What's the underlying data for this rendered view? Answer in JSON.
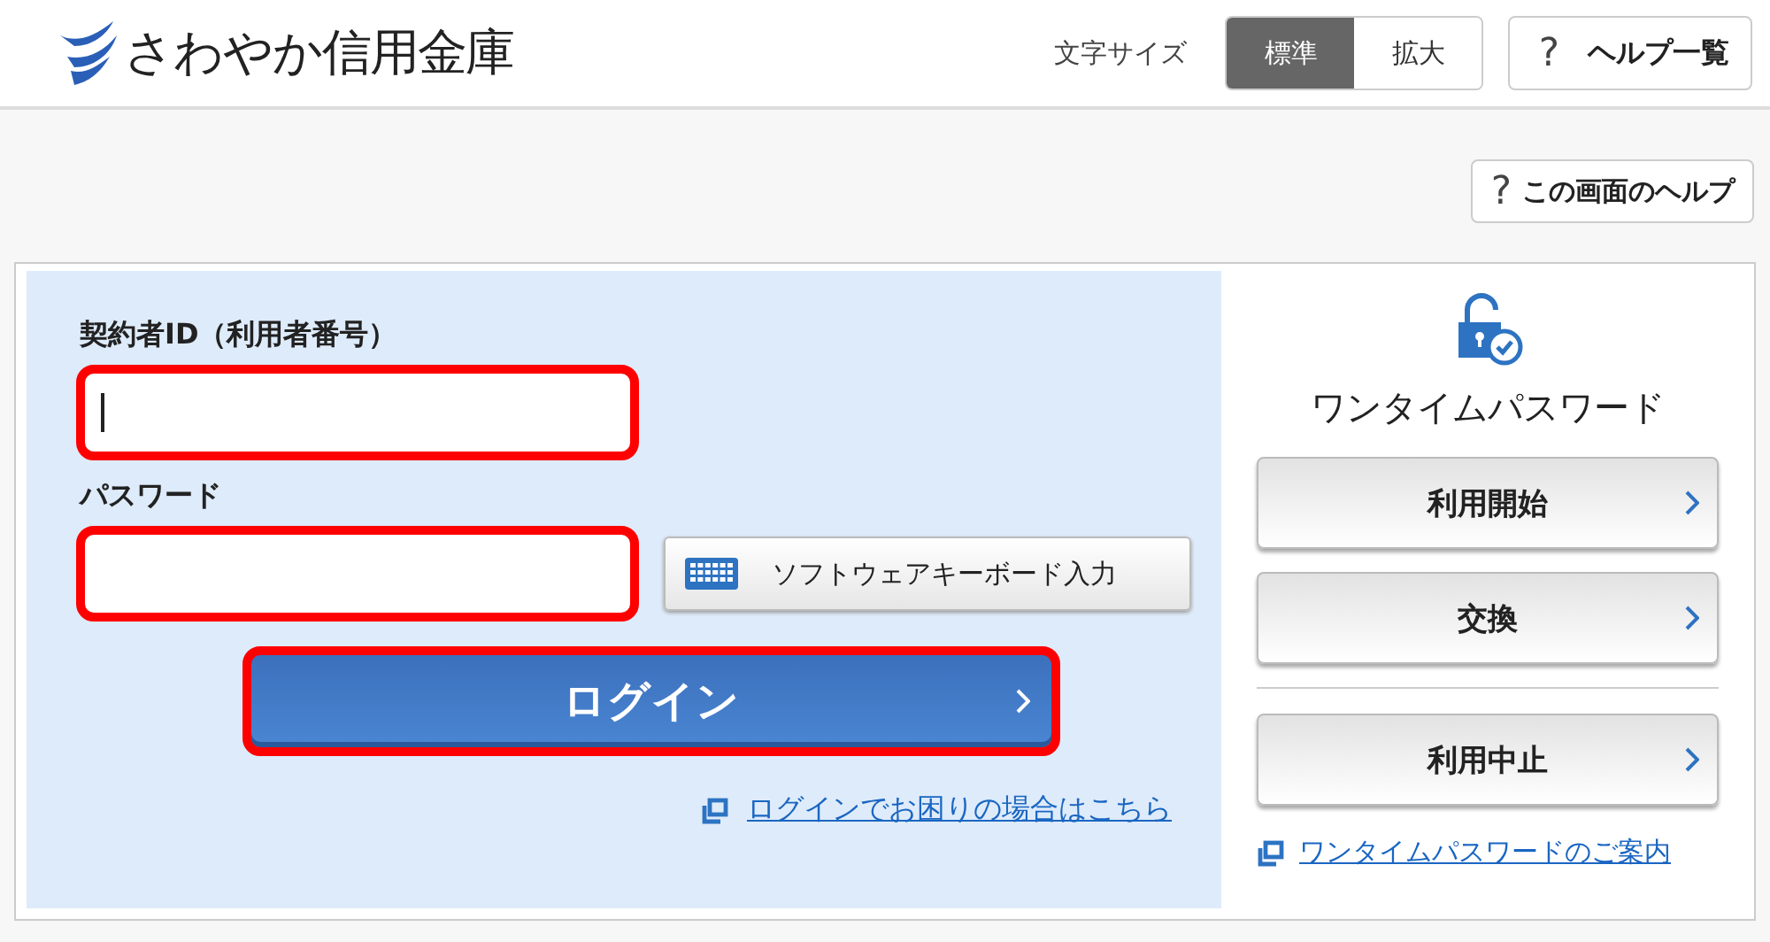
{
  "header": {
    "brand": "さわやか信用金庫",
    "font_size": {
      "label": "文字サイズ",
      "options": [
        {
          "label": "標準",
          "selected": true
        },
        {
          "label": "拡大",
          "selected": false
        }
      ]
    },
    "help_list": {
      "icon": "?",
      "label": "ヘルプ一覧"
    }
  },
  "screen_help": {
    "icon": "?",
    "label": "この画面のヘルプ"
  },
  "login": {
    "fields": [
      {
        "label": "契約者ID（利用者番号）",
        "kind": "text",
        "highlighted": true,
        "focused": true
      },
      {
        "label": "パスワード",
        "kind": "password",
        "highlighted": true,
        "focused": false
      }
    ],
    "keyboard_button": "ソフトウェアキーボード入力",
    "submit": {
      "label": "ログイン",
      "highlighted": true
    },
    "trouble_link": "ログインでお困りの場合はこちら"
  },
  "one_time_password": {
    "title": "ワンタイムパスワード",
    "buttons": [
      {
        "label": "利用開始"
      },
      {
        "label": "交換"
      },
      {
        "label": "利用中止"
      }
    ],
    "guide_link": "ワンタイムパスワードのご案内"
  }
}
